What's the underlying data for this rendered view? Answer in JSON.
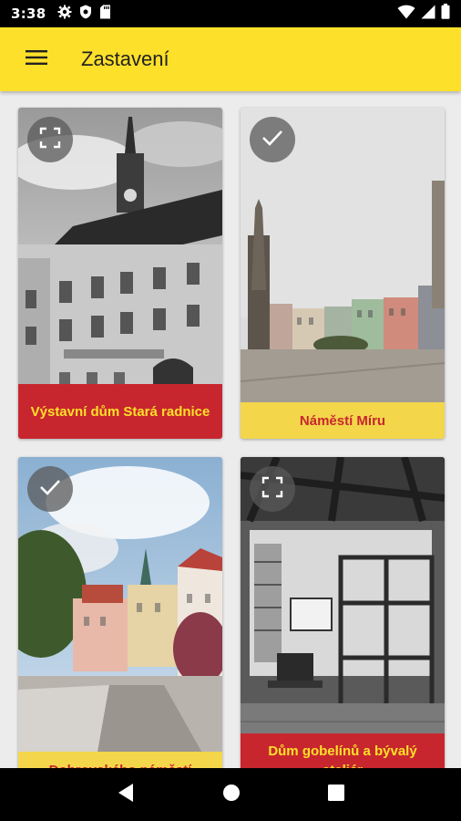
{
  "status": {
    "time": "3:38",
    "left_icons": [
      "gear-icon",
      "shield-icon",
      "sd-card-icon"
    ],
    "right_icons": [
      "wifi-icon",
      "signal-icon",
      "battery-icon"
    ]
  },
  "app_bar": {
    "title": "Zastavení",
    "menu_icon": "menu-icon"
  },
  "cards": [
    {
      "caption": "Výstavní dům Stará radnice",
      "badge": "expand-icon",
      "caption_style": "red"
    },
    {
      "caption": "Náměstí Míru",
      "badge": "check-icon",
      "caption_style": "yellow"
    },
    {
      "caption": "Dobrovského náměstí",
      "badge": "check-icon",
      "caption_style": "yellow"
    },
    {
      "caption": "Dům gobelínů a bývalý ateliér",
      "badge": "expand-icon",
      "caption_style": "red"
    }
  ],
  "nav": {
    "icons": [
      "back-icon",
      "home-icon",
      "recents-icon"
    ]
  },
  "colors": {
    "app_bar": "#fde02a",
    "caption_red": "#c8262e",
    "caption_yellow": "#f3d64a"
  }
}
